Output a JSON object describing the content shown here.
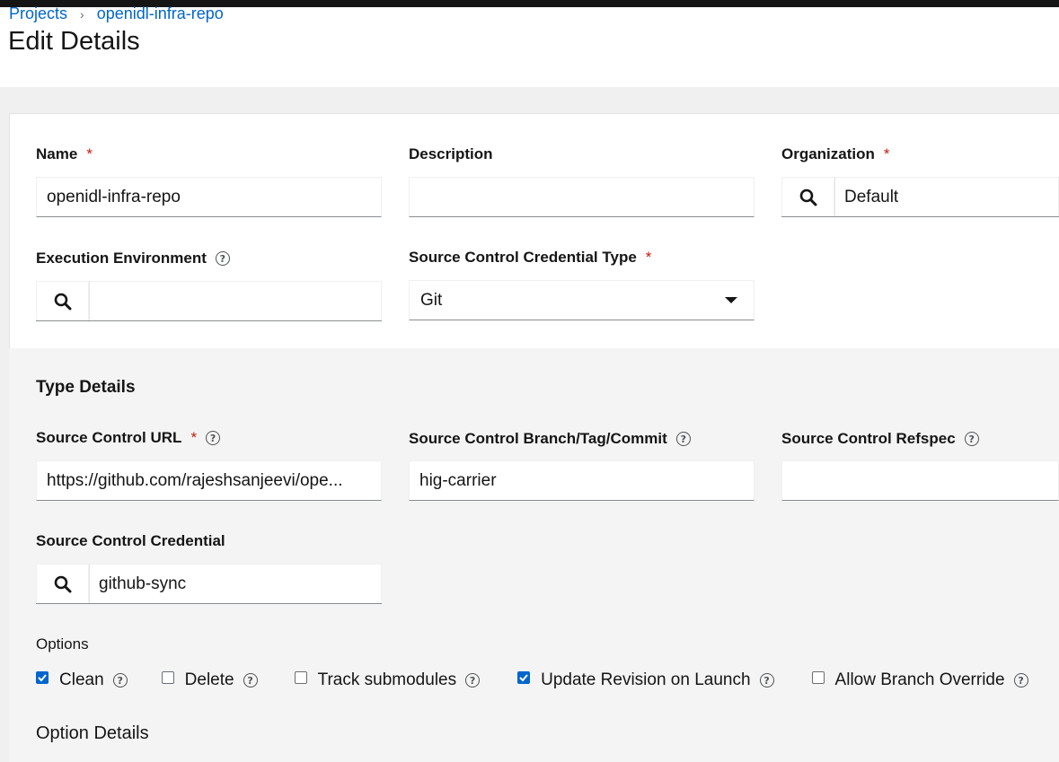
{
  "breadcrumb": {
    "projects": "Projects",
    "separator": "›",
    "current": "openidl-infra-repo"
  },
  "page": {
    "title": "Edit Details"
  },
  "form": {
    "name": {
      "label": "Name",
      "required": "*",
      "value": "openidl-infra-repo"
    },
    "description": {
      "label": "Description",
      "value": ""
    },
    "organization": {
      "label": "Organization",
      "required": "*",
      "value": "Default"
    },
    "execution_environment": {
      "label": "Execution Environment",
      "help": "?",
      "value": ""
    },
    "credential_type": {
      "label": "Source Control Credential Type",
      "required": "*",
      "value": "Git"
    }
  },
  "type_details": {
    "title": "Type Details",
    "url": {
      "label": "Source Control URL",
      "required": "*",
      "help": "?",
      "value": "https://github.com/rajeshsanjeevi/ope..."
    },
    "branch": {
      "label": "Source Control Branch/Tag/Commit",
      "help": "?",
      "value": "hig-carrier"
    },
    "refspec": {
      "label": "Source Control Refspec",
      "help": "?",
      "value": ""
    },
    "credential": {
      "label": "Source Control Credential",
      "value": "github-sync"
    },
    "options": {
      "label": "Options",
      "items": [
        {
          "label": "Clean",
          "checked": true,
          "help": "?"
        },
        {
          "label": "Delete",
          "checked": false,
          "help": "?"
        },
        {
          "label": "Track submodules",
          "checked": false,
          "help": "?"
        },
        {
          "label": "Update Revision on Launch",
          "checked": true,
          "help": "?"
        },
        {
          "label": "Allow Branch Override",
          "checked": false,
          "help": "?"
        }
      ]
    },
    "option_details_title": "Option Details"
  },
  "colors": {
    "link": "#0066cc",
    "required": "#c9190b",
    "checkbox_checked": "#0066cc",
    "subform_bg": "#f4f4f4"
  }
}
